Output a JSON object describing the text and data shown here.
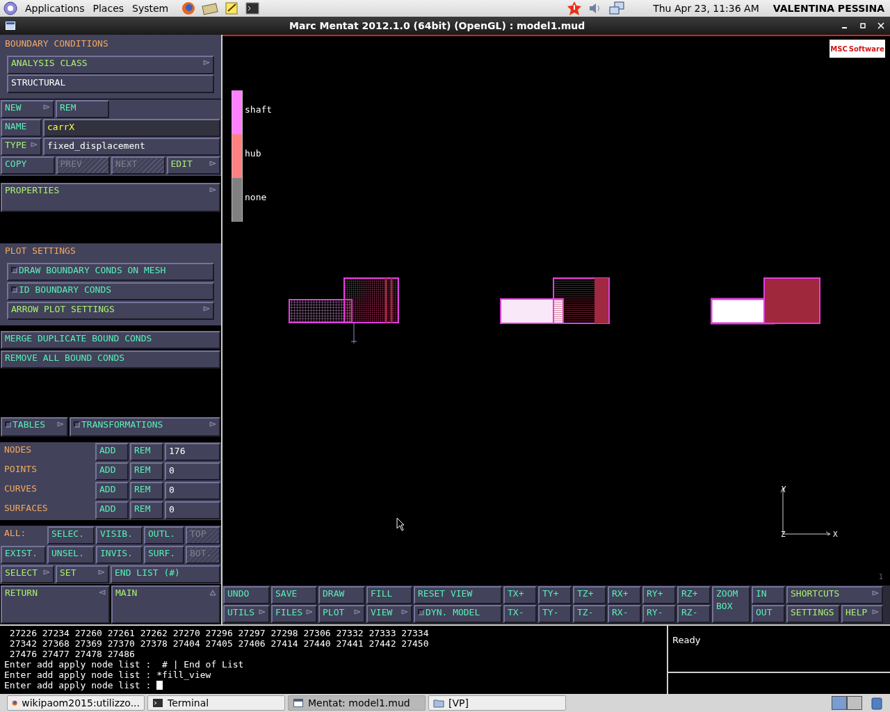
{
  "top_panel": {
    "menus": [
      "Applications",
      "Places",
      "System"
    ],
    "clock": "Thu Apr 23, 11:36 AM",
    "user": "VALENTINA PESSINA"
  },
  "window": {
    "title": "Marc Mentat 2012.1.0 (64bit) (OpenGL) : model1.mud"
  },
  "boundary_conditions": {
    "title": "BOUNDARY CONDITIONS",
    "analysis_class": {
      "label": "ANALYSIS CLASS",
      "kind": "menu",
      "submenu": true
    },
    "analysis_value": "STRUCTURAL",
    "row_new": [
      {
        "label": "NEW",
        "kind": "action",
        "submenu": true
      },
      {
        "label": "REM",
        "kind": "action",
        "submenu": false
      }
    ],
    "name": {
      "button": {
        "label": "NAME",
        "kind": "action"
      },
      "value": "carrX"
    },
    "type": {
      "button": {
        "label": "TYPE",
        "kind": "menu",
        "submenu": true
      },
      "value": "fixed_displacement"
    },
    "nav": [
      {
        "label": "COPY",
        "kind": "action",
        "submenu": false
      },
      {
        "label": "PREV",
        "kind": "disabled",
        "submenu": false
      },
      {
        "label": "NEXT",
        "kind": "disabled",
        "submenu": false
      },
      {
        "label": "EDIT",
        "kind": "menu",
        "submenu": true
      }
    ],
    "properties": {
      "label": "PROPERTIES",
      "kind": "menu",
      "submenu": true
    }
  },
  "plot_settings": {
    "title": "PLOT SETTINGS",
    "items": [
      {
        "label": "DRAW BOUNDARY CONDS ON MESH",
        "kind": "toggle",
        "checked": false,
        "submenu": false
      },
      {
        "label": "ID BOUNDARY CONDS",
        "kind": "toggle",
        "checked": false,
        "submenu": false
      },
      {
        "label": "ARROW PLOT SETTINGS",
        "kind": "menu",
        "submenu": true
      }
    ]
  },
  "actions": [
    {
      "label": "MERGE DUPLICATE BOUND CONDS",
      "kind": "action"
    },
    {
      "label": "REMOVE ALL BOUND CONDS",
      "kind": "action"
    }
  ],
  "menus_row": [
    {
      "label": "TABLES",
      "kind": "toggle",
      "checked": false,
      "submenu": true
    },
    {
      "label": "TRANSFORMATIONS",
      "kind": "toggle",
      "checked": false,
      "submenu": true
    }
  ],
  "entities": [
    {
      "label": "NODES",
      "add": {
        "label": "ADD",
        "kind": "action"
      },
      "rem": {
        "label": "REM",
        "kind": "action"
      },
      "count": "176"
    },
    {
      "label": "POINTS",
      "add": {
        "label": "ADD",
        "kind": "action"
      },
      "rem": {
        "label": "REM",
        "kind": "action"
      },
      "count": "0"
    },
    {
      "label": "CURVES",
      "add": {
        "label": "ADD",
        "kind": "action"
      },
      "rem": {
        "label": "REM",
        "kind": "action"
      },
      "count": "0"
    },
    {
      "label": "SURFACES",
      "add": {
        "label": "ADD",
        "kind": "action"
      },
      "rem": {
        "label": "REM",
        "kind": "action"
      },
      "count": "0"
    }
  ],
  "selection": {
    "all_label": "ALL:",
    "row1": [
      {
        "label": "SELEC.",
        "kind": "action"
      },
      {
        "label": "VISIB.",
        "kind": "action"
      },
      {
        "label": "OUTL.",
        "kind": "action"
      },
      {
        "label": "TOP",
        "kind": "disabled"
      }
    ],
    "row2": [
      {
        "label": "EXIST.",
        "kind": "action"
      },
      {
        "label": "UNSEL.",
        "kind": "action"
      },
      {
        "label": "INVIS.",
        "kind": "action"
      },
      {
        "label": "SURF.",
        "kind": "action"
      },
      {
        "label": "BOT.",
        "kind": "disabled"
      }
    ],
    "row3": [
      {
        "label": "SELECT",
        "kind": "menu",
        "submenu": true
      },
      {
        "label": "SET",
        "kind": "menu",
        "submenu": true
      },
      {
        "label": "END LIST (#)",
        "kind": "action",
        "submenu": false
      }
    ]
  },
  "return_row": [
    {
      "label": "RETURN",
      "kind": "back"
    },
    {
      "label": "MAIN",
      "kind": "home"
    }
  ],
  "viewport": {
    "legend": [
      {
        "label": "shaft",
        "color": "#ff80ff"
      },
      {
        "label": "hub",
        "color": "#ff8080"
      },
      {
        "label": "none",
        "color": "#808080"
      }
    ],
    "logo": {
      "brand": "MSC",
      "word": "Software"
    },
    "axes": {
      "y": "Y",
      "z": "Z",
      "x": "X"
    },
    "corner": "1"
  },
  "toolbar": [
    [
      {
        "label": "UNDO",
        "kind": "action",
        "submenu": false
      },
      {
        "label": "UTILS",
        "kind": "action",
        "submenu": true
      }
    ],
    [
      {
        "label": "SAVE",
        "kind": "action",
        "submenu": false
      },
      {
        "label": "FILES",
        "kind": "action",
        "submenu": true
      }
    ],
    [
      {
        "label": "DRAW",
        "kind": "action",
        "submenu": false
      },
      {
        "label": "PLOT",
        "kind": "action",
        "submenu": true
      }
    ],
    [
      {
        "label": "FILL",
        "kind": "action",
        "submenu": false
      },
      {
        "label": "VIEW",
        "kind": "action",
        "submenu": true
      }
    ],
    [
      {
        "label": "RESET VIEW",
        "kind": "action"
      },
      {
        "label": "DYN. MODEL",
        "kind": "toggle",
        "checked": false
      }
    ],
    [
      {
        "label": "TX+",
        "kind": "action"
      },
      {
        "label": "TX-",
        "kind": "action"
      }
    ],
    [
      {
        "label": "TY+",
        "kind": "action"
      },
      {
        "label": "TY-",
        "kind": "action"
      }
    ],
    [
      {
        "label": "TZ+",
        "kind": "action"
      },
      {
        "label": "TZ-",
        "kind": "action"
      }
    ],
    [
      {
        "label": "RX+",
        "kind": "action"
      },
      {
        "label": "RX-",
        "kind": "action"
      }
    ],
    [
      {
        "label": "RY+",
        "kind": "action"
      },
      {
        "label": "RY-",
        "kind": "action"
      }
    ],
    [
      {
        "label": "RZ+",
        "kind": "action"
      },
      {
        "label": "RZ-",
        "kind": "action"
      }
    ],
    [
      {
        "label": "ZOOM BOX",
        "kind": "action"
      }
    ],
    [
      {
        "label": "IN",
        "kind": "action"
      },
      {
        "label": "OUT",
        "kind": "action"
      }
    ],
    [
      {
        "label": "SHORTCUTS",
        "kind": "menu",
        "submenu": true
      },
      {
        "label": "SETTINGS",
        "kind": "menu",
        "submenu": false
      },
      {
        "label": "HELP",
        "kind": "menu",
        "submenu": true
      }
    ]
  ],
  "console": {
    "lines": [
      " 27226 27234 27260 27261 27262 27270 27296 27297 27298 27306 27332 27333 27334",
      " 27342 27368 27369 27370 27378 27404 27405 27406 27414 27440 27441 27442 27450",
      " 27476 27477 27478 27486",
      "Enter add apply node list :  # | End of List",
      "Enter add apply node list : *fill_view"
    ],
    "prompt": "Enter add apply node list : ",
    "status": "Ready"
  },
  "taskbar": [
    {
      "label": "wikipaom2015:utilizzo...",
      "kind": "browser",
      "selected": false
    },
    {
      "label": "Terminal",
      "kind": "terminal",
      "selected": false
    },
    {
      "label": "Mentat: model1.mud",
      "kind": "window",
      "selected": true
    },
    {
      "label": "[VP]",
      "kind": "folder",
      "selected": false
    }
  ]
}
